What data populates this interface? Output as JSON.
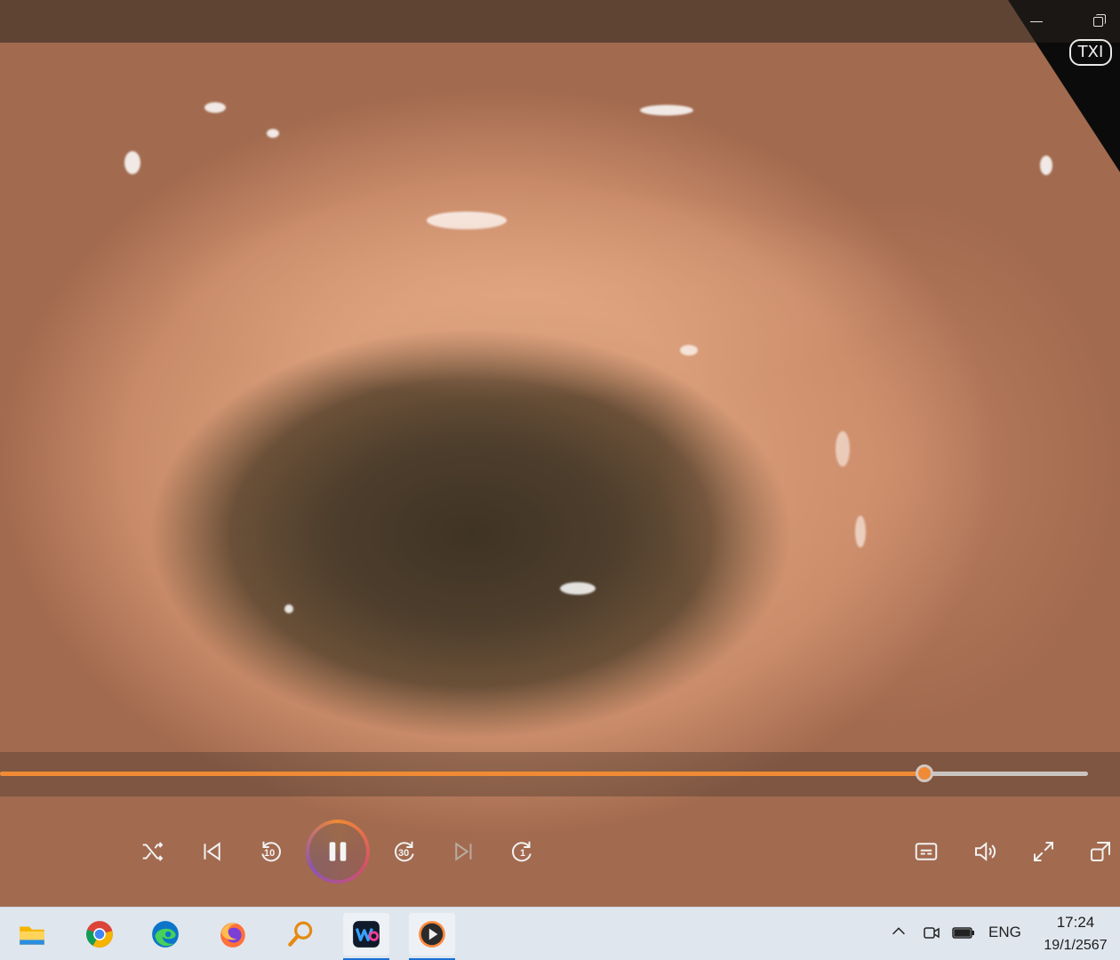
{
  "player": {
    "badge_text": "TXI",
    "progress_fraction": 0.85,
    "skip_back_seconds": "10",
    "skip_forward_seconds": "30",
    "repeat_count": "1",
    "state": "playing",
    "accent_color": "#f08a34"
  },
  "window_controls": {
    "minimize_icon": "minimize-icon",
    "restore_icon": "restore-icon"
  },
  "controls": {
    "icons": [
      "shuffle-icon",
      "previous-icon",
      "skip-back-icon",
      "pause-icon",
      "skip-forward-icon",
      "next-icon",
      "repeat-one-icon",
      "subtitles-icon",
      "volume-icon",
      "fullscreen-icon",
      "mini-player-icon"
    ]
  },
  "taskbar": {
    "apps": [
      "file-explorer-icon",
      "chrome-icon",
      "edge-icon",
      "firefox-icon",
      "search-app-icon",
      "app-icon",
      "media-player-icon"
    ],
    "active_apps": [
      "app-icon",
      "media-player-icon"
    ],
    "tray": {
      "language": "ENG",
      "time": "17:24",
      "date": "19/1/2567"
    }
  }
}
